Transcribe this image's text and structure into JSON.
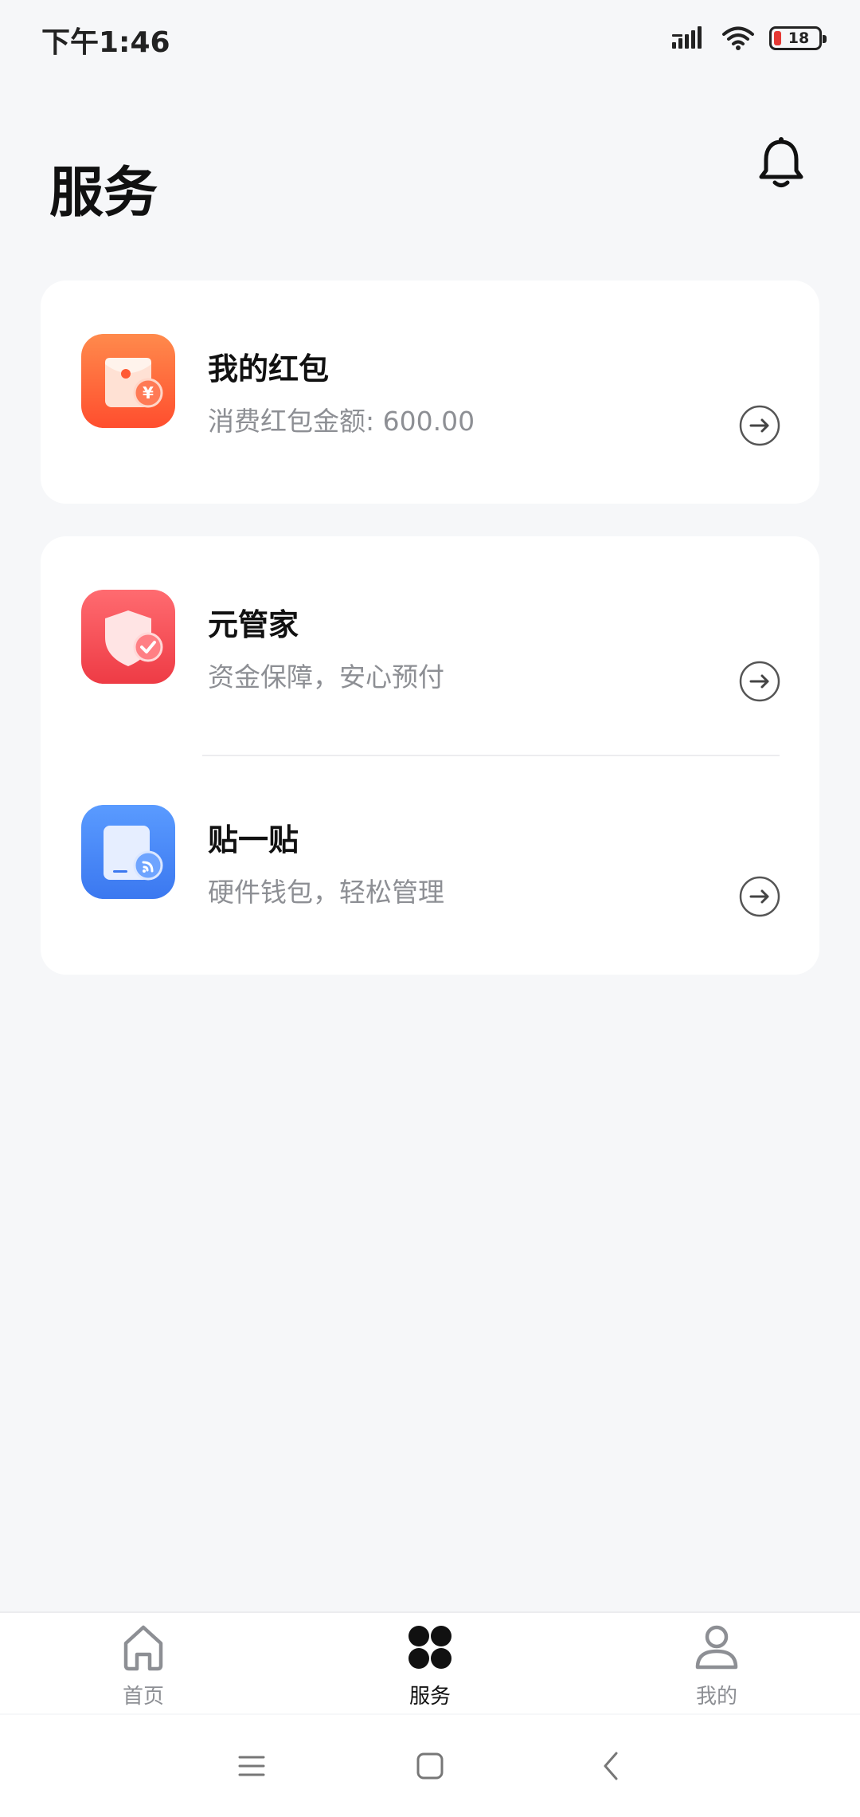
{
  "status_bar": {
    "time": "下午1:46",
    "battery_level": "18",
    "icons": [
      "signal-icon",
      "wifi-icon",
      "battery-icon"
    ]
  },
  "header": {
    "title": "服务",
    "notification_icon": "bell-icon"
  },
  "services": {
    "red_packet": {
      "title": "我的红包",
      "subtitle": "消费红包金额: 600.00",
      "icon": "red-packet-icon"
    },
    "steward": {
      "title": "元管家",
      "subtitle": "资金保障，安心预付",
      "icon": "shield-check-icon"
    },
    "tap": {
      "title": "贴一贴",
      "subtitle": "硬件钱包，轻松管理",
      "icon": "nfc-card-icon"
    }
  },
  "bottom_nav": {
    "items": [
      {
        "label": "首页",
        "icon": "home-icon",
        "active": false
      },
      {
        "label": "服务",
        "icon": "four-dots-icon",
        "active": true
      },
      {
        "label": "我的",
        "icon": "person-icon",
        "active": false
      }
    ]
  },
  "colors": {
    "background": "#f6f7f9",
    "card": "#ffffff",
    "red_packet_orange": "#ff6a3d",
    "steward_red": "#f2454f",
    "tap_blue": "#4285f4",
    "subtitle_gray": "#8d8f94"
  }
}
